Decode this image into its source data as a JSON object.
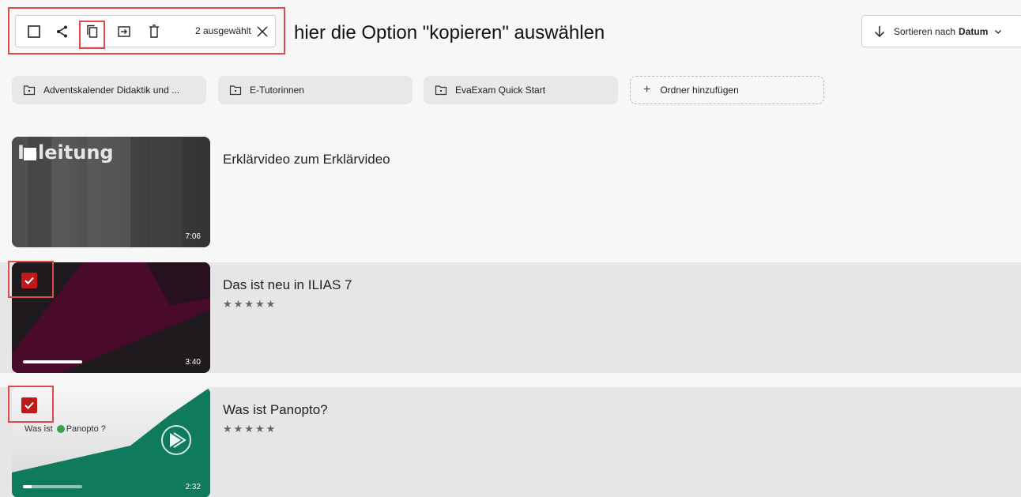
{
  "toolbar": {
    "selected_count": "2 ausgewählt",
    "icons": [
      "select-all-checkbox-icon",
      "share-icon",
      "copy-icon",
      "move-icon",
      "trash-icon",
      "close-icon"
    ]
  },
  "annotation": "hier die Option \"kopieren\" auswählen",
  "sort": {
    "label": "Sortieren nach",
    "value": "Datum"
  },
  "folders": [
    {
      "label": "Adventskalender Didaktik und ..."
    },
    {
      "label": "E-Tutorinnen"
    },
    {
      "label": "EvaExam Quick Start"
    }
  ],
  "add_folder_label": "Ordner hinzufügen",
  "videos": [
    {
      "title": "Erklärvideo zum Erklärvideo",
      "duration": "7:06",
      "thumb_text": "nleitung",
      "stars": "",
      "selected": false
    },
    {
      "title": "Das ist neu in ILIAS 7",
      "duration": "3:40",
      "stars": "★★★★★",
      "selected": true,
      "progress": 1.0
    },
    {
      "title": "Was ist Panopto?",
      "duration": "2:32",
      "stars": "★★★★★",
      "selected": true,
      "progress": 0.15,
      "thumb_text_a": "Was ist",
      "thumb_text_b": "Panopto",
      "thumb_text_c": "?"
    }
  ],
  "colors": {
    "accent_red": "#c01919",
    "annotation_red": "#e04a4a",
    "panopto_green": "#0f7a5c"
  }
}
